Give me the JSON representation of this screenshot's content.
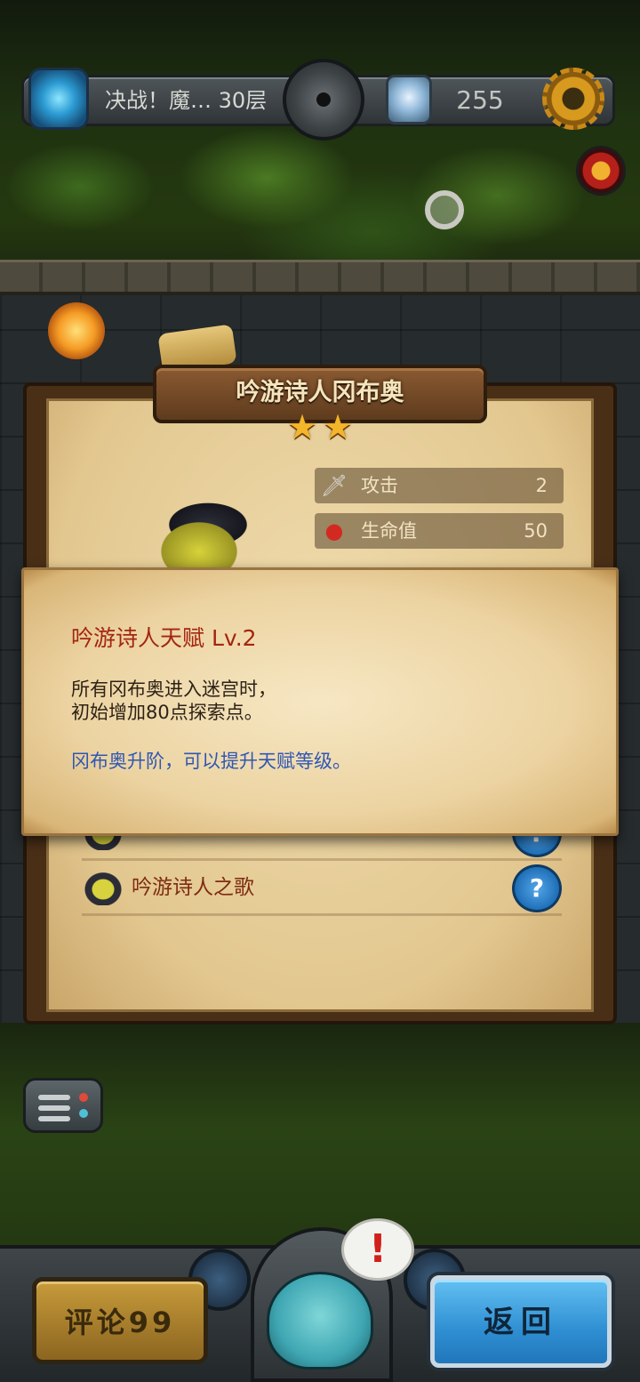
{
  "top_bar": {
    "level_name": "决战！魔… 30层",
    "gold_count": "255"
  },
  "hero_card": {
    "name": "吟游诗人冈布奥",
    "stars": 2,
    "stats": [
      {
        "icon": "sword-icon",
        "label": "攻击",
        "value": "2"
      },
      {
        "icon": "potion-icon",
        "label": "生命值",
        "value": "50"
      }
    ],
    "talents": [
      {
        "name": "吟游诗人之歌"
      }
    ]
  },
  "talent_popup": {
    "title": "吟游诗人天赋 Lv.2",
    "description_lines": [
      "所有冈布奥进入迷宫时，",
      "初始增加80点探索点。"
    ],
    "hint": "冈布奥升阶，可以提升天赋等级。"
  },
  "bottom_bar": {
    "review_label": "评论99",
    "back_label": "返回",
    "alert_mark": "!"
  },
  "colors": {
    "popup_title": "#a32611",
    "popup_hint": "#2f57b4",
    "back_button": "#2f8fd2",
    "review_button": "#c79b3a"
  }
}
